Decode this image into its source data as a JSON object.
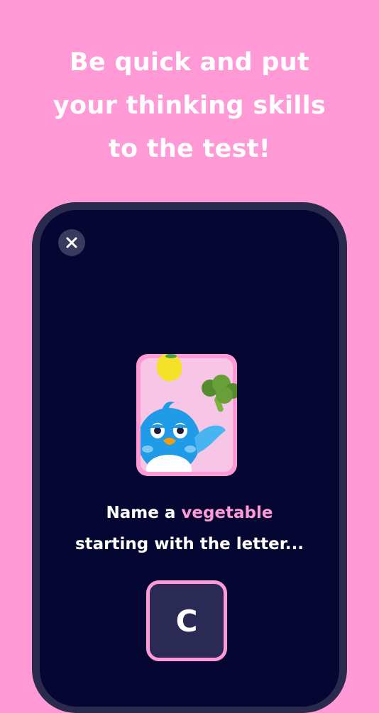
{
  "headline": {
    "lines": [
      "Be quick and put",
      "your thinking skills",
      "to the test!"
    ]
  },
  "game": {
    "close_icon": "close-icon",
    "card_illustration": "bird-with-vegetables",
    "prompt": {
      "prefix": "Name a ",
      "category": "vegetable",
      "line2": "starting with the letter..."
    },
    "letter": "C"
  },
  "colors": {
    "background": "#FF9AD6",
    "phone_frame": "#2A2A4E",
    "screen": "#050632",
    "accent": "#FF9AD6",
    "bird": "#1F9BE8"
  }
}
